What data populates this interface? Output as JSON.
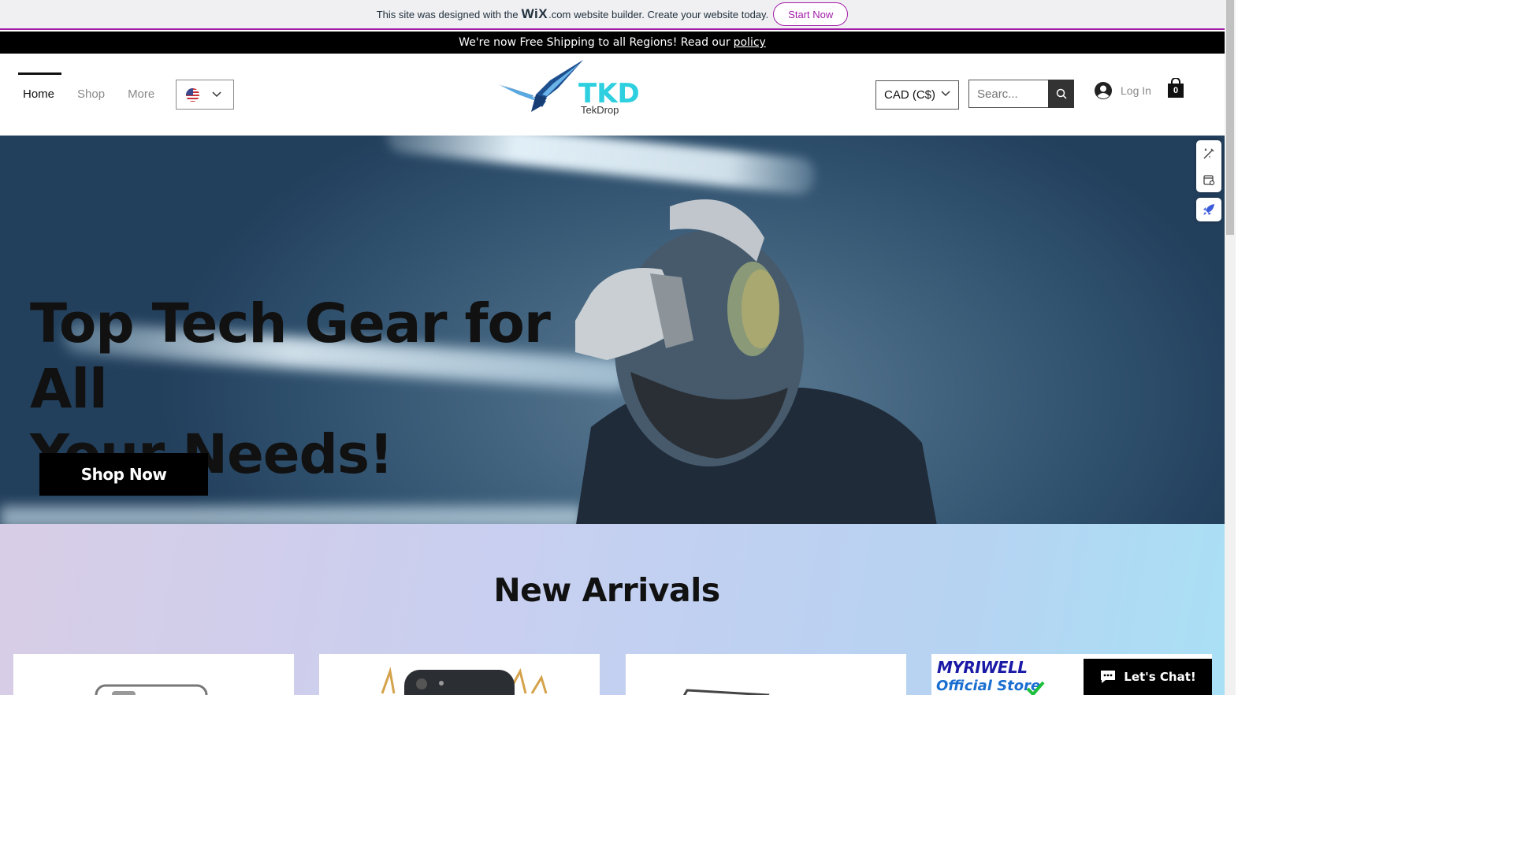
{
  "wix_banner": {
    "text_before": "This site was designed with the",
    "logo_text": "WiX",
    "logo_suffix": ".com",
    "text_after": "website builder. Create your website today.",
    "start_button": "Start Now"
  },
  "shipping_bar": {
    "text": "We're now Free Shipping to all Regions! Read our",
    "link": "policy"
  },
  "nav": {
    "items": [
      {
        "label": "Home",
        "active": true
      },
      {
        "label": "Shop",
        "active": false
      },
      {
        "label": "More",
        "active": false
      }
    ],
    "language_flag": "us-flag-icon"
  },
  "logo": {
    "title": "TKD",
    "subtitle": "TekDrop"
  },
  "currency": {
    "selected": "CAD (C$)"
  },
  "search": {
    "placeholder": "Searc..."
  },
  "login": {
    "label": "Log In"
  },
  "cart": {
    "count": "0"
  },
  "hero": {
    "title_line1": "Top Tech Gear for All",
    "title_line2": "Your Needs!",
    "button": "Shop Now"
  },
  "new_arrivals": {
    "title": "New Arrivals",
    "brand_logo": "MYRIWELL",
    "brand_tag": "Official Store"
  },
  "chat": {
    "label": "Let's Chat!"
  },
  "colors": {
    "wix_accent": "#a21ca8",
    "logo_cyan": "#2ed0e0",
    "hero_bg": "#43647f"
  }
}
